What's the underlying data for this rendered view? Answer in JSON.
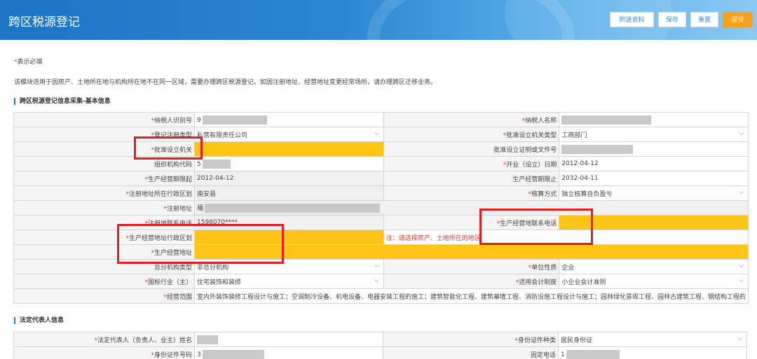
{
  "app": {
    "title": "跨区税源登记"
  },
  "toolbar": {
    "attach": "附送资料",
    "save": "保存",
    "reset": "重置",
    "submit": "提交"
  },
  "notes": {
    "required_star": "*",
    "required_text": "表示必填",
    "description": "该模块适用于因房产、土地所在地与机构所在地不在同一区域，需要办理跨区税源登记。如因注册地址、经营地址变更经常场所，请办理跨区迁移业务。"
  },
  "section1": {
    "title": "跨区税源登记信息采集-基本信息"
  },
  "basic": {
    "taxpayer_id_label": "*纳税人识别号",
    "taxpayer_id_value": "9",
    "taxpayer_name_label": "*纳税人名称",
    "reg_type_label": "*登记注册类型",
    "reg_type_value": "私营有限责任公司",
    "approving_type_label": "*批准设立机关类型",
    "approving_type_value": "工商部门",
    "approving_org_label": "*批准设立机关",
    "approval_doc_label": "批准设立证明或文件号",
    "org_code_label": "组织机构代码",
    "org_code_value": "5",
    "open_date_label": "*开业（设立）日期",
    "open_date_value": "2012-04-12",
    "period_start_label": "*生产经营期限起",
    "period_start_value": "2012-04-12",
    "period_end_label": "生产经营期限止",
    "period_end_value": "2032-04-11",
    "reg_region_label": "*注册地址所在行政区划",
    "reg_region_value": "南安县",
    "accounting_label": "*核算方式",
    "accounting_value": "独立核算自负盈亏",
    "reg_addr_label": "*注册地址",
    "reg_addr_value": "福",
    "reg_phone_label": "*注册地联系电话",
    "reg_phone_value": "1598070****",
    "biz_phone_label": "*生产经营地联系电话",
    "biz_region_label": "*生产经营地址行政区划",
    "biz_region_note": "注：请选择房产、土地所在的地区",
    "biz_addr_label": "*生产经营地址",
    "branch_type_label": "总分机构类型",
    "branch_type_value": "非总分机构",
    "unit_nature_label": "*单位性质",
    "unit_nature_value": "企业",
    "industry_label": "*国标行业（主）",
    "industry_value": "住宅装饰和装修",
    "acct_system_label": "*适用会计制度",
    "acct_system_value": "小企业会计准则",
    "scope_label": "*经营范围",
    "scope_value": "室内外装饰装修工程设计与施工；空调制冷设备、机电设备、电器安装工程的施工；建筑智能化工程、建筑幕墙工程、消防设施工程设计与施工；园林绿化景观工程、园林古建筑工程、钢结构工程的"
  },
  "section2": {
    "title": "法定代表人信息"
  },
  "legal": {
    "name_label": "*法定代表人（负责人、业主）姓名",
    "id_type_label": "*身份证件种类",
    "id_type_value": "居民身份证",
    "id_no_label": "*身份证件号码",
    "id_no_value": "3",
    "phone_label": "固定电话",
    "phone_value": "1"
  },
  "icons": {
    "dropdown": "chevron-down-icon"
  },
  "colors": {
    "header": "#2a86d2",
    "submit": "#f7a21b",
    "highlight": "#ffc516",
    "annotation": "#e01e22"
  }
}
